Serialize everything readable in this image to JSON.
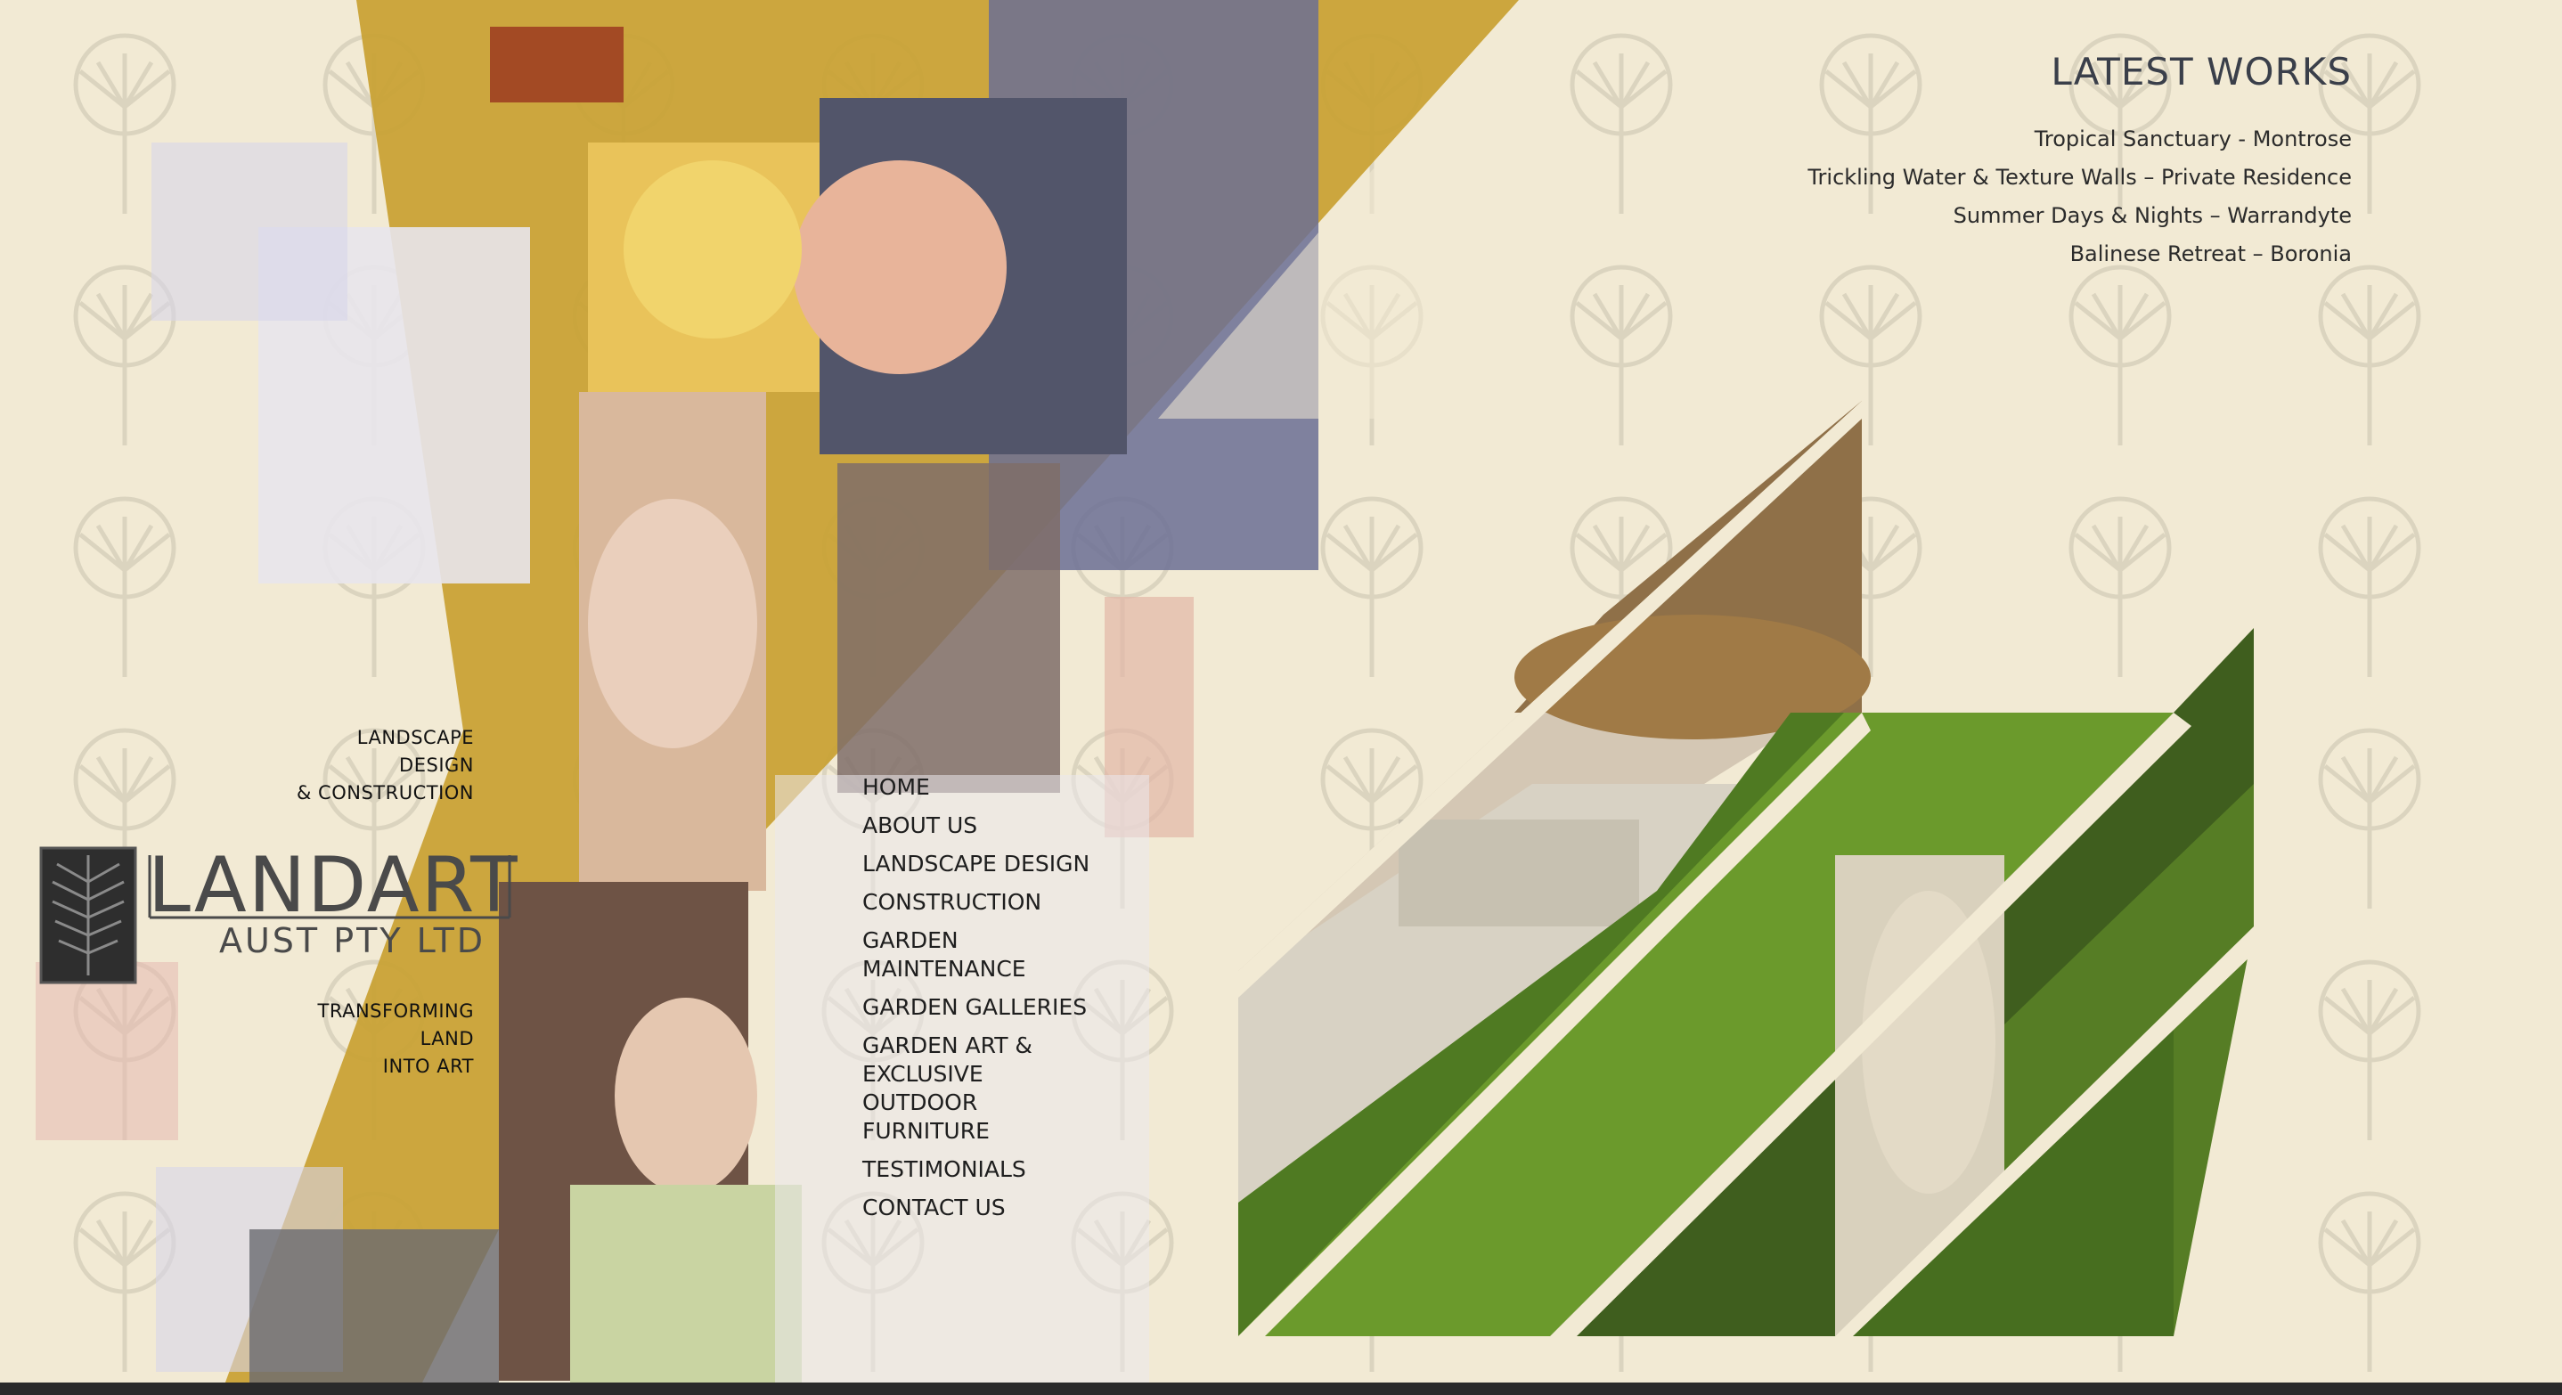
{
  "latest_works": {
    "heading": "LATEST WORKS",
    "items": [
      "Tropical Sanctuary - Montrose",
      "Trickling Water & Texture Walls – Private Residence",
      "Summer Days & Nights – Warrandyte",
      "Balinese Retreat – Boronia"
    ]
  },
  "tagline_top": [
    "LANDSCAPE",
    "DESIGN",
    "& CONSTRUCTION"
  ],
  "tagline_bottom": [
    "TRANSFORMING",
    "LAND",
    "INTO ART"
  ],
  "logo": {
    "main": "LANDART",
    "sub": "AUST PTY LTD",
    "icon": "leaf-icon"
  },
  "nav": {
    "items": [
      "HOME",
      "ABOUT US",
      "LANDSCAPE DESIGN",
      "CONSTRUCTION",
      "GARDEN MAINTENANCE",
      "GARDEN GALLERIES",
      "GARDEN ART & EXCLUSIVE OUTDOOR FURNITURE",
      "TESTIMONIALS",
      "CONTACT US"
    ]
  },
  "colors": {
    "background": "#f2ead4",
    "mustard": "#c9a236",
    "slate_blue": "#6b6f94",
    "leaf_green": "#5e8a2a",
    "stone": "#cfc6b3",
    "text_dark": "#1e1e1e"
  }
}
